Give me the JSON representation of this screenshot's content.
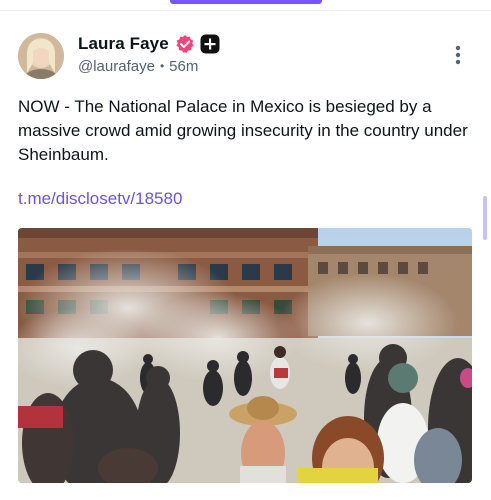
{
  "post": {
    "author": {
      "display_name": "Laura Faye",
      "handle": "@laurafaye",
      "avatar_icon": "avatar-photo",
      "verified_icon": "verified-badge-icon",
      "app_badge_icon": "plus-app-icon"
    },
    "separator": "•",
    "time_ago": "56m",
    "text": "NOW - The National Palace in Mexico is besieged by a massive crowd amid growing insecurity in the country under Sheinbaum.",
    "link": "t.me/disclosetv/18580",
    "media": {
      "type": "photo",
      "icon": "protest-photo"
    }
  },
  "colors": {
    "accent": "#7856ff",
    "link": "#6a54d9",
    "verified": "#f0447a",
    "secondary_text": "#536471"
  }
}
